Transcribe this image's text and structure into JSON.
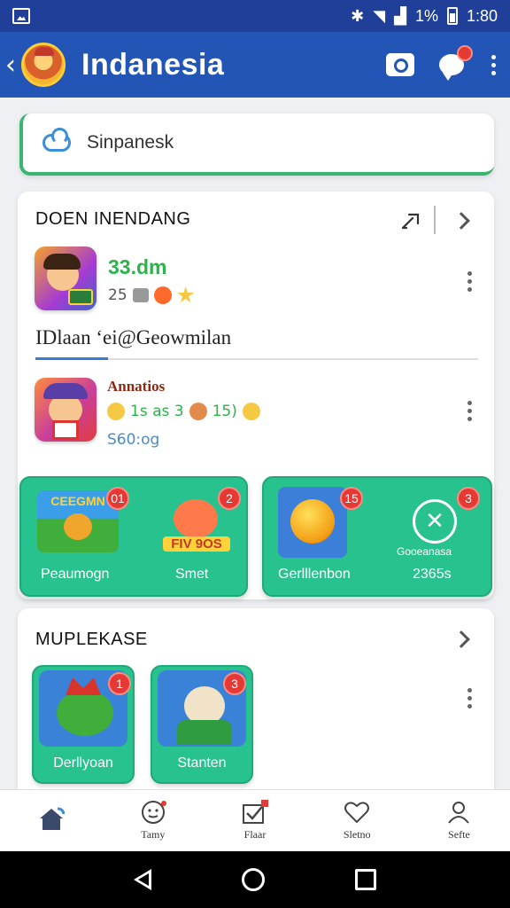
{
  "status_bar": {
    "battery": "1%",
    "time": "1:80"
  },
  "app_bar": {
    "title": "Indanesia",
    "back_icon": "back-icon",
    "camera_icon": "camera-icon",
    "chat_icon": "chat-icon"
  },
  "search": {
    "placeholder": "Sinpanesk"
  },
  "section1": {
    "title": "DOEN INENDANG",
    "game1": {
      "name": "33.dm",
      "count": "25"
    },
    "row_title": "IDlaan  ‘ei@Geowmilan",
    "game2": {
      "name": "Annatios",
      "meta": "1s  as  3",
      "meta2": "15)",
      "sub": "S60:og"
    },
    "tiles": [
      {
        "label": "Peaumogn",
        "badge": "01",
        "art_text": "CEEGMN"
      },
      {
        "label": "Smet",
        "badge": "2",
        "art_text": "FIV 9OS"
      },
      {
        "label": "Gerlllenbon",
        "badge": "15"
      },
      {
        "label": "2365s",
        "badge": "3",
        "art_text": "Gooeanasa"
      }
    ]
  },
  "section2": {
    "title": "MUPLEKASE",
    "tiles": [
      {
        "label": "Derllyoan",
        "badge": "1"
      },
      {
        "label": "Stanten",
        "badge": "3"
      }
    ]
  },
  "bottom_nav": [
    {
      "label": "",
      "icon": "home-icon"
    },
    {
      "label": "Tamy",
      "icon": "face-icon"
    },
    {
      "label": "Flaar",
      "icon": "checkbox-icon"
    },
    {
      "label": "Sletno",
      "icon": "heart-icon"
    },
    {
      "label": "Sefte",
      "icon": "profile-icon"
    }
  ],
  "colors": {
    "app_bar": "#2255b6",
    "accent_green": "#28c28e",
    "badge_red": "#e53935"
  }
}
